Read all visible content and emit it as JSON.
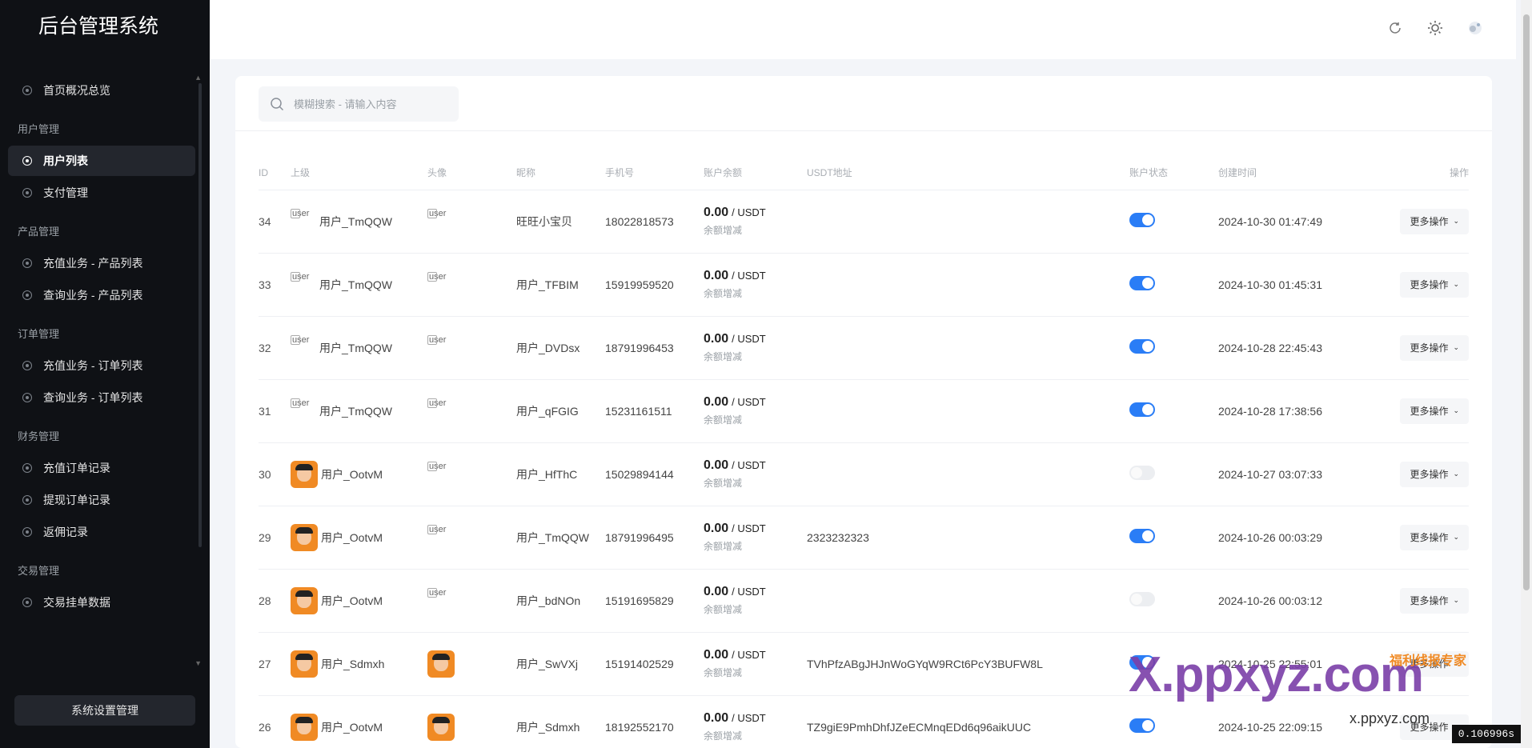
{
  "app": {
    "title": "后台管理系统"
  },
  "sidebar": {
    "items": [
      {
        "type": "item",
        "label": "首页概况总览",
        "active": false,
        "name": "dashboard"
      },
      {
        "type": "group",
        "label": "用户管理"
      },
      {
        "type": "item",
        "label": "用户列表",
        "active": true,
        "name": "user-list"
      },
      {
        "type": "item",
        "label": "支付管理",
        "active": false,
        "name": "payment"
      },
      {
        "type": "group",
        "label": "产品管理"
      },
      {
        "type": "item",
        "label": "充值业务 - 产品列表",
        "active": false,
        "name": "recharge-products"
      },
      {
        "type": "item",
        "label": "查询业务 - 产品列表",
        "active": false,
        "name": "query-products"
      },
      {
        "type": "group",
        "label": "订单管理"
      },
      {
        "type": "item",
        "label": "充值业务 - 订单列表",
        "active": false,
        "name": "recharge-orders"
      },
      {
        "type": "item",
        "label": "查询业务 - 订单列表",
        "active": false,
        "name": "query-orders"
      },
      {
        "type": "group",
        "label": "财务管理"
      },
      {
        "type": "item",
        "label": "充值订单记录",
        "active": false,
        "name": "recharge-records"
      },
      {
        "type": "item",
        "label": "提现订单记录",
        "active": false,
        "name": "withdraw-records"
      },
      {
        "type": "item",
        "label": "返佣记录",
        "active": false,
        "name": "commission-records"
      },
      {
        "type": "group",
        "label": "交易管理"
      },
      {
        "type": "item",
        "label": "交易挂单数据",
        "active": false,
        "name": "trade-orders"
      }
    ],
    "settings_label": "系统设置管理"
  },
  "search": {
    "placeholder": "模糊搜索 - 请输入内容",
    "value": ""
  },
  "table": {
    "headers": [
      "ID",
      "上级",
      "头像",
      "昵称",
      "手机号",
      "账户余额",
      "USDT地址",
      "账户状态",
      "创建时间",
      "操作"
    ],
    "broken_img_alt": "user",
    "balance_unit": "/ USDT",
    "balance_sub": "余额增减",
    "more_label": "更多操作",
    "rows": [
      {
        "id": "34",
        "upline": "用户_TmQQW",
        "upline_avatar": "broken",
        "avatar": "broken",
        "nickname": "旺旺小宝贝",
        "phone": "18022818573",
        "balance": "0.00",
        "usdt": "",
        "status": true,
        "created": "2024-10-30 01:47:49"
      },
      {
        "id": "33",
        "upline": "用户_TmQQW",
        "upline_avatar": "broken",
        "avatar": "broken",
        "nickname": "用户_TFBIM",
        "phone": "15919959520",
        "balance": "0.00",
        "usdt": "",
        "status": true,
        "created": "2024-10-30 01:45:31"
      },
      {
        "id": "32",
        "upline": "用户_TmQQW",
        "upline_avatar": "broken",
        "avatar": "broken",
        "nickname": "用户_DVDsx",
        "phone": "18791996453",
        "balance": "0.00",
        "usdt": "",
        "status": true,
        "created": "2024-10-28 22:45:43"
      },
      {
        "id": "31",
        "upline": "用户_TmQQW",
        "upline_avatar": "broken",
        "avatar": "broken",
        "nickname": "用户_qFGIG",
        "phone": "15231161511",
        "balance": "0.00",
        "usdt": "",
        "status": true,
        "created": "2024-10-28 17:38:56"
      },
      {
        "id": "30",
        "upline": "用户_OotvM",
        "upline_avatar": "photo",
        "avatar": "broken",
        "nickname": "用户_HfThC",
        "phone": "15029894144",
        "balance": "0.00",
        "usdt": "",
        "status": false,
        "created": "2024-10-27 03:07:33"
      },
      {
        "id": "29",
        "upline": "用户_OotvM",
        "upline_avatar": "photo",
        "avatar": "broken",
        "nickname": "用户_TmQQW",
        "phone": "18791996495",
        "balance": "0.00",
        "usdt": "2323232323",
        "status": true,
        "created": "2024-10-26 00:03:29"
      },
      {
        "id": "28",
        "upline": "用户_OotvM",
        "upline_avatar": "photo",
        "avatar": "broken",
        "nickname": "用户_bdNOn",
        "phone": "15191695829",
        "balance": "0.00",
        "usdt": "",
        "status": false,
        "created": "2024-10-26 00:03:12"
      },
      {
        "id": "27",
        "upline": "用户_Sdmxh",
        "upline_avatar": "photo",
        "avatar": "photo",
        "nickname": "用户_SwVXj",
        "phone": "15191402529",
        "balance": "0.00",
        "usdt": "TVhPfzABgJHJnWoGYqW9RCt6PcY3BUFW8L",
        "status": true,
        "created": "2024-10-25 22:55:01"
      },
      {
        "id": "26",
        "upline": "用户_OotvM",
        "upline_avatar": "photo",
        "avatar": "photo",
        "nickname": "用户_Sdmxh",
        "phone": "18192552170",
        "balance": "0.00",
        "usdt": "TZ9giE9PmhDhfJZeECMnqEDd6q96aikUUC",
        "status": true,
        "created": "2024-10-25 22:09:15"
      }
    ]
  },
  "overlay": {
    "timer": "0.106996s",
    "watermark_main": "X.ppxyz.com",
    "watermark_sub": "x.ppxyz.com",
    "watermark_brand": "福利线报专家"
  },
  "icons": [
    "refresh-icon",
    "sun-icon",
    "theme-toggle-icon",
    "search-icon",
    "chevron-down-icon"
  ],
  "colors": {
    "sidebar_bg": "#0f1115",
    "accent": "#2a7df6",
    "page_bg": "#f3f5f9"
  }
}
